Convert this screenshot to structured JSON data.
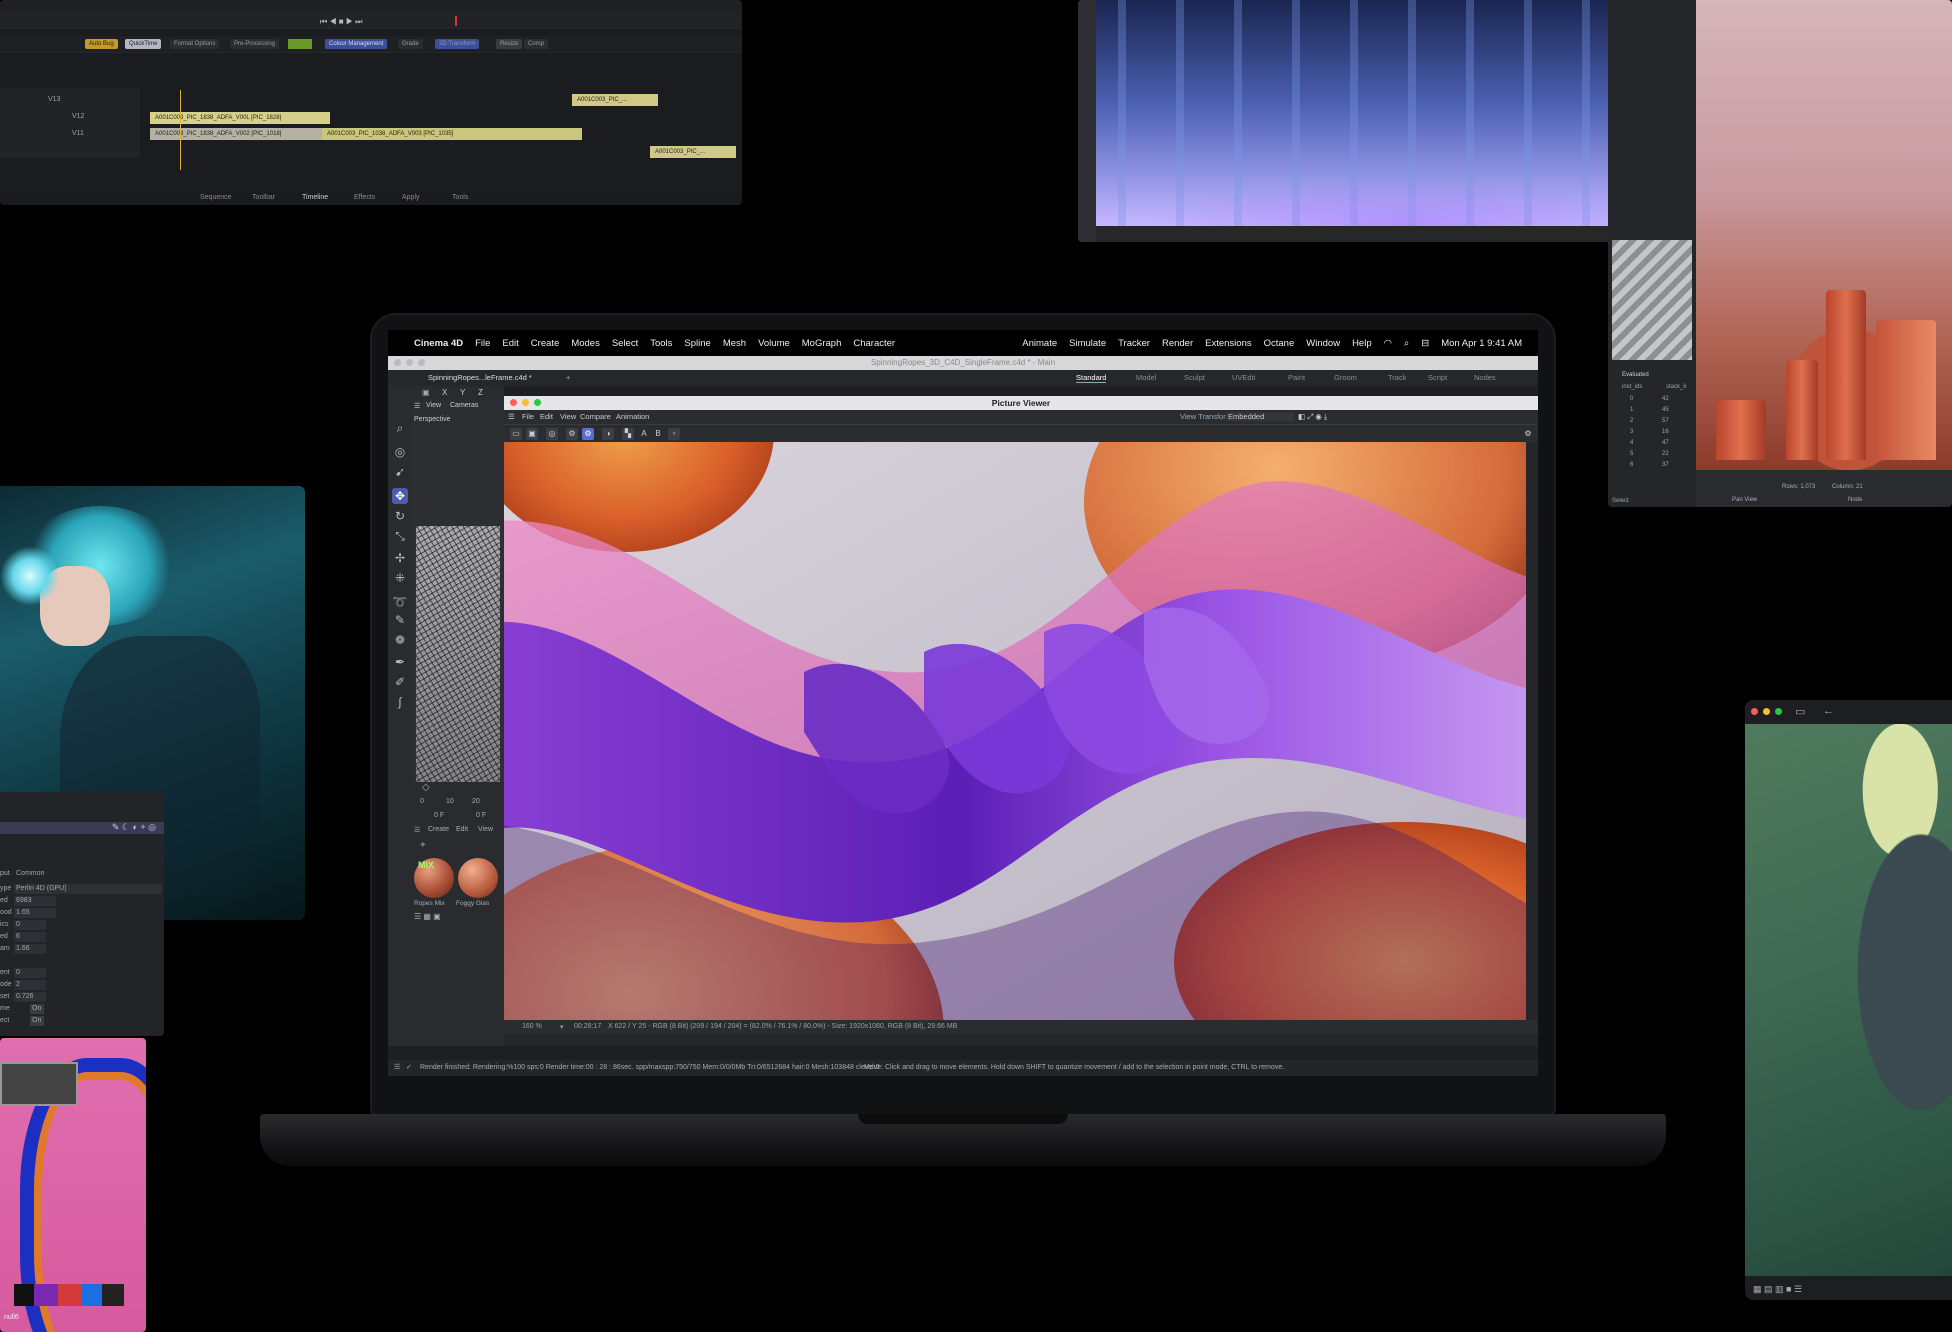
{
  "menubar": {
    "app_name": "Cinema 4D",
    "items_left": [
      "File",
      "Edit",
      "Create",
      "Modes",
      "Select",
      "Tools",
      "Spline",
      "Mesh",
      "Volume",
      "MoGraph",
      "Character"
    ],
    "items_right": [
      "Animate",
      "Simulate",
      "Tracker",
      "Render",
      "Extensions",
      "Octane",
      "Window",
      "Help"
    ],
    "clock": "Mon Apr 1  9:41 AM"
  },
  "c4d": {
    "window_title": "SpinningRopes_3D_C4D_SingleFrame.c4d * - Main",
    "doc_tab": "SpinningRopes...leFrame.c4d *",
    "layout_tabs": [
      "Standard",
      "Model",
      "Sculpt",
      "UVEdit",
      "Paint",
      "Groom",
      "Track",
      "Script",
      "Nodes"
    ],
    "selected_layout": "Standard",
    "viewport_menu": [
      "View",
      "Cameras"
    ],
    "viewport_label": "Perspective",
    "axes": [
      "X",
      "Y",
      "Z"
    ],
    "timeline": {
      "ticks": [
        "0",
        "10",
        "20"
      ],
      "frame_a": "0 F",
      "frame_b": "0 F"
    },
    "material_menu": [
      "Create",
      "Edit",
      "View"
    ],
    "materials": [
      {
        "name": "Ropes Mix",
        "badge": "MIX",
        "color": "#b0604a"
      },
      {
        "name": "Foggy Glas",
        "badge": "",
        "color": "#c26a4e"
      }
    ],
    "status_render": "Render finished: Rendering:%100 sps:0 Render time:00 : 28 : 86sec. spp/maxspp:750/750 Mem:0/0/0Mb Tri:0/6512684 hair:0 Mesh:103848 clevel:0",
    "status_hint": "Move: Click and drag to move elements. Hold down SHIFT to quantize movement / add to the selection in point mode, CTRL to remove."
  },
  "picture_viewer": {
    "title": "Picture Viewer",
    "menu": [
      "File",
      "Edit",
      "View",
      "Compare",
      "Animation"
    ],
    "view_transform_label": "View Transform",
    "view_transform_value": "Embedded",
    "zoom": "160 %",
    "timecode": "00:28:17",
    "pixel_info": "X 622 / Y 25 - RGB (8 Bit) (209 / 194 / 204) = (82.0% / 76.1% / 80.0%) - Size: 1920x1080, RGB (8 Bit), 29.66 MB"
  },
  "edit_panel": {
    "tracks": [
      "V13",
      "V12",
      "V11"
    ],
    "clips": [
      "A001C003_PIC_1838_ADFA_V00L [PIC_1828]",
      "A001C003_PIC_1838_ADFA_V002 [PIC_1018]",
      "A001C003_PIC_1038_ADFA_V003 [PIC_1035]",
      "A001C003_PIC_...",
      "A001C003_PIC_..."
    ],
    "buttons": [
      "Auto Bug",
      "QuickTime",
      "Format Options",
      "Pre-Processing",
      "Colour Management",
      "Grade",
      "2D Transform",
      "Resize",
      "Comp"
    ],
    "bottom_tabs": [
      "Sequence",
      "Toolbar",
      "Timeline",
      "Effects",
      "Apply",
      "Tools"
    ]
  },
  "props_panel": {
    "tabs": [
      "put",
      "Common"
    ],
    "rows": [
      {
        "label": "ype",
        "value": "Perlin 4D (GPU)"
      },
      {
        "label": "ed",
        "value": "6983"
      },
      {
        "label": "ood",
        "value": "1.65"
      },
      {
        "label": "ics",
        "value": "0"
      },
      {
        "label": "ed",
        "value": "6"
      },
      {
        "label": "am",
        "value": "1.66"
      },
      {
        "label": "ent",
        "value": "0"
      },
      {
        "label": "ode",
        "value": "2"
      },
      {
        "label": "set",
        "value": "0.726"
      },
      {
        "label": "me",
        "value": "On"
      },
      {
        "label": "ect",
        "value": "On"
      }
    ]
  },
  "render3d_panel": {
    "header": "Evaluated",
    "col_a": "inst_ids",
    "col_b": "stack_li",
    "rows": [
      [
        "0",
        "42"
      ],
      [
        "1",
        "45"
      ],
      [
        "2",
        "57"
      ],
      [
        "3",
        "16"
      ],
      [
        "4",
        "47"
      ],
      [
        "5",
        "22"
      ],
      [
        "6",
        "37"
      ]
    ],
    "rows_info": "Rows: 1,073",
    "columns_info": "Column: 21",
    "footer": [
      "Select",
      "Pan View",
      "Node"
    ]
  },
  "glitch_panel": {
    "label": "null6"
  }
}
